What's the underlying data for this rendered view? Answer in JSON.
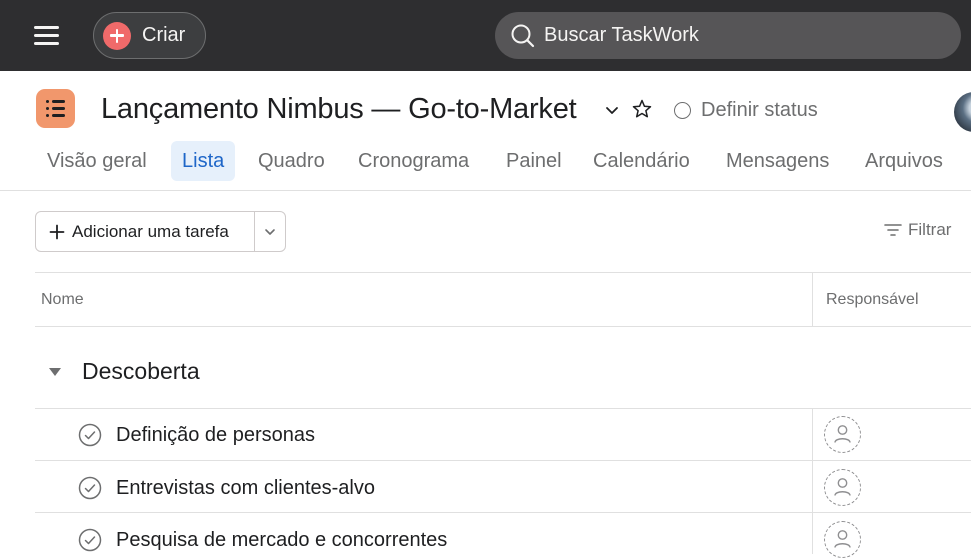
{
  "topbar": {
    "create_label": "Criar",
    "search_placeholder": "Buscar TaskWork"
  },
  "colors": {
    "topbar_bg": "#2e2e30",
    "create_accent": "#f06a6a",
    "project_icon": "#f1976c",
    "active_tab_text": "#1e66c8",
    "active_tab_bg": "#e6f0fb"
  },
  "project": {
    "title": "Lançamento Nimbus — Go-to-Market",
    "status_label": "Definir status",
    "icon": "list-icon"
  },
  "tabs": [
    {
      "label": "Visão geral"
    },
    {
      "label": "Lista",
      "active": true
    },
    {
      "label": "Quadro"
    },
    {
      "label": "Cronograma"
    },
    {
      "label": "Painel"
    },
    {
      "label": "Calendário"
    },
    {
      "label": "Mensagens"
    },
    {
      "label": "Arquivos"
    }
  ],
  "toolbar": {
    "add_task_label": "Adicionar uma tarefa",
    "filter_label": "Filtrar"
  },
  "table": {
    "columns": [
      "Nome",
      "Responsável"
    ],
    "sections": [
      {
        "title": "Descoberta",
        "tasks": [
          {
            "name": "Definição de personas"
          },
          {
            "name": "Entrevistas com clientes-alvo"
          },
          {
            "name": "Pesquisa de mercado e concorrentes"
          }
        ]
      }
    ]
  }
}
